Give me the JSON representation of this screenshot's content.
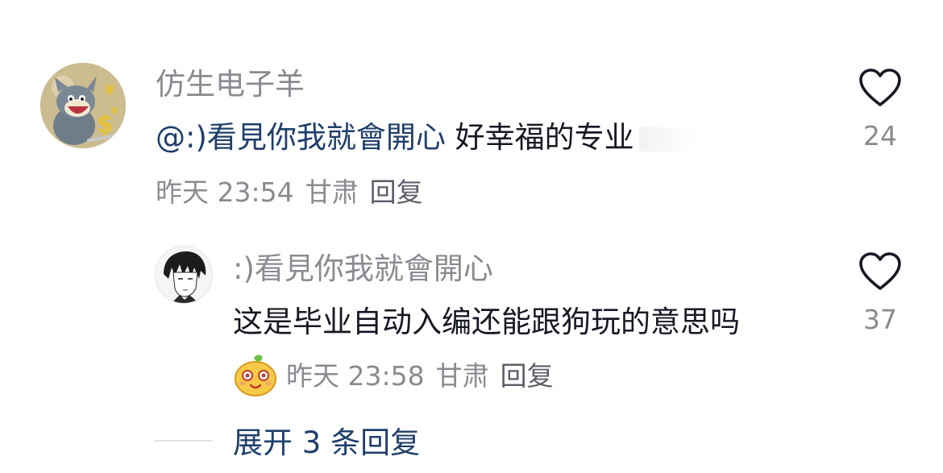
{
  "comment": {
    "username": "仿生电子羊",
    "mention": "@:)看見你我就會開心",
    "text": " 好幸福的专业",
    "time": "昨天 23:54",
    "location": "甘肃",
    "reply_label": "回复",
    "likes": "24"
  },
  "reply": {
    "username": ":)看見你我就會開心",
    "text": "这是毕业自动入编还能跟狗玩的意思吗",
    "time": "昨天 23:58",
    "location": "甘肃",
    "reply_label": "回复",
    "likes": "37"
  },
  "expand": {
    "label": "展开 3 条回复"
  },
  "colors": {
    "mention": "#1f3f6b",
    "meta_gray": "#8a8b91",
    "text": "#161823"
  }
}
